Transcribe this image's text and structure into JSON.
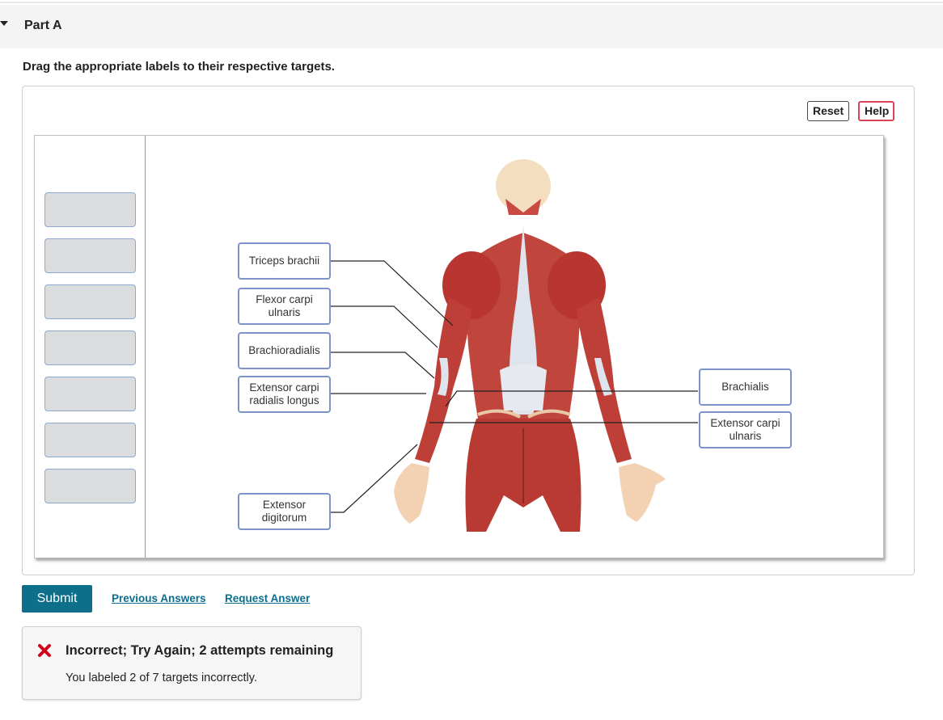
{
  "part": {
    "title": "Part A"
  },
  "instructions": "Drag the appropriate labels to their respective targets.",
  "toolbar": {
    "reset_label": "Reset",
    "help_label": "Help"
  },
  "label_bank": {
    "empty_slots": 7
  },
  "figure": {
    "subject": "posterior muscles of the human body"
  },
  "labels": {
    "triceps": "Triceps brachii",
    "flexor_carpi_ulnaris_1": "Flexor carpi",
    "flexor_carpi_ulnaris_2": "ulnaris",
    "brachioradialis": "Brachioradialis",
    "ecrl_1": "Extensor carpi",
    "ecrl_2": "radialis longus",
    "extensor_digitorum_1": "Extensor",
    "extensor_digitorum_2": "digitorum",
    "brachialis": "Brachialis",
    "ecu_1": "Extensor carpi",
    "ecu_2": "ulnaris"
  },
  "actions": {
    "submit_label": "Submit",
    "previous_answers_label": "Previous Answers",
    "request_answer_label": "Request Answer"
  },
  "feedback": {
    "title": "Incorrect; Try Again; 2 attempts remaining",
    "detail": "You labeled 2 of 7 targets incorrectly."
  },
  "colors": {
    "accent": "#0e6f8a",
    "error": "#d0021b",
    "label_border": "#7e93c9",
    "muscle": "#c0392b"
  }
}
